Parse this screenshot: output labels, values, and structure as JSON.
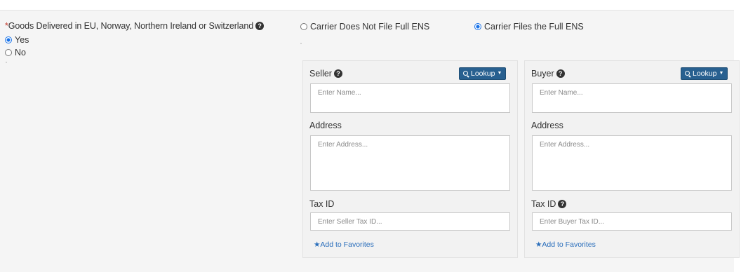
{
  "question": {
    "required_mark": "*",
    "label": "Goods Delivered in EU, Norway, Northern Ireland or Switzerland",
    "help_glyph": "?",
    "options": [
      {
        "label": "Yes",
        "checked": true
      },
      {
        "label": "No",
        "checked": false
      }
    ]
  },
  "ens": {
    "options": [
      {
        "label": "Carrier Does Not File Full ENS",
        "checked": false
      },
      {
        "label": "Carrier Files the Full ENS",
        "checked": true
      }
    ]
  },
  "seller": {
    "title": "Seller",
    "lookup_label": "Lookup",
    "name_placeholder": "Enter Name...",
    "address_label": "Address",
    "address_placeholder": "Enter Address...",
    "tax_label": "Tax ID",
    "tax_placeholder": "Enter Seller Tax ID...",
    "favorites_label": "★Add to Favorites"
  },
  "buyer": {
    "title": "Buyer",
    "lookup_label": "Lookup",
    "name_placeholder": "Enter Name...",
    "address_label": "Address",
    "address_placeholder": "Enter Address...",
    "tax_label": "Tax ID",
    "tax_placeholder": "Enter Buyer Tax ID...",
    "favorites_label": "★Add to Favorites"
  },
  "colors": {
    "panel_bg": "#f5f5f5",
    "accent": "#1a73e8",
    "button_bg": "#286090",
    "link": "#2a6ebb",
    "required": "#c0392b"
  },
  "icons": {
    "help": "question-circle-icon",
    "lookup": "search-icon",
    "caret": "caret-down-icon",
    "favorite": "star-icon"
  }
}
